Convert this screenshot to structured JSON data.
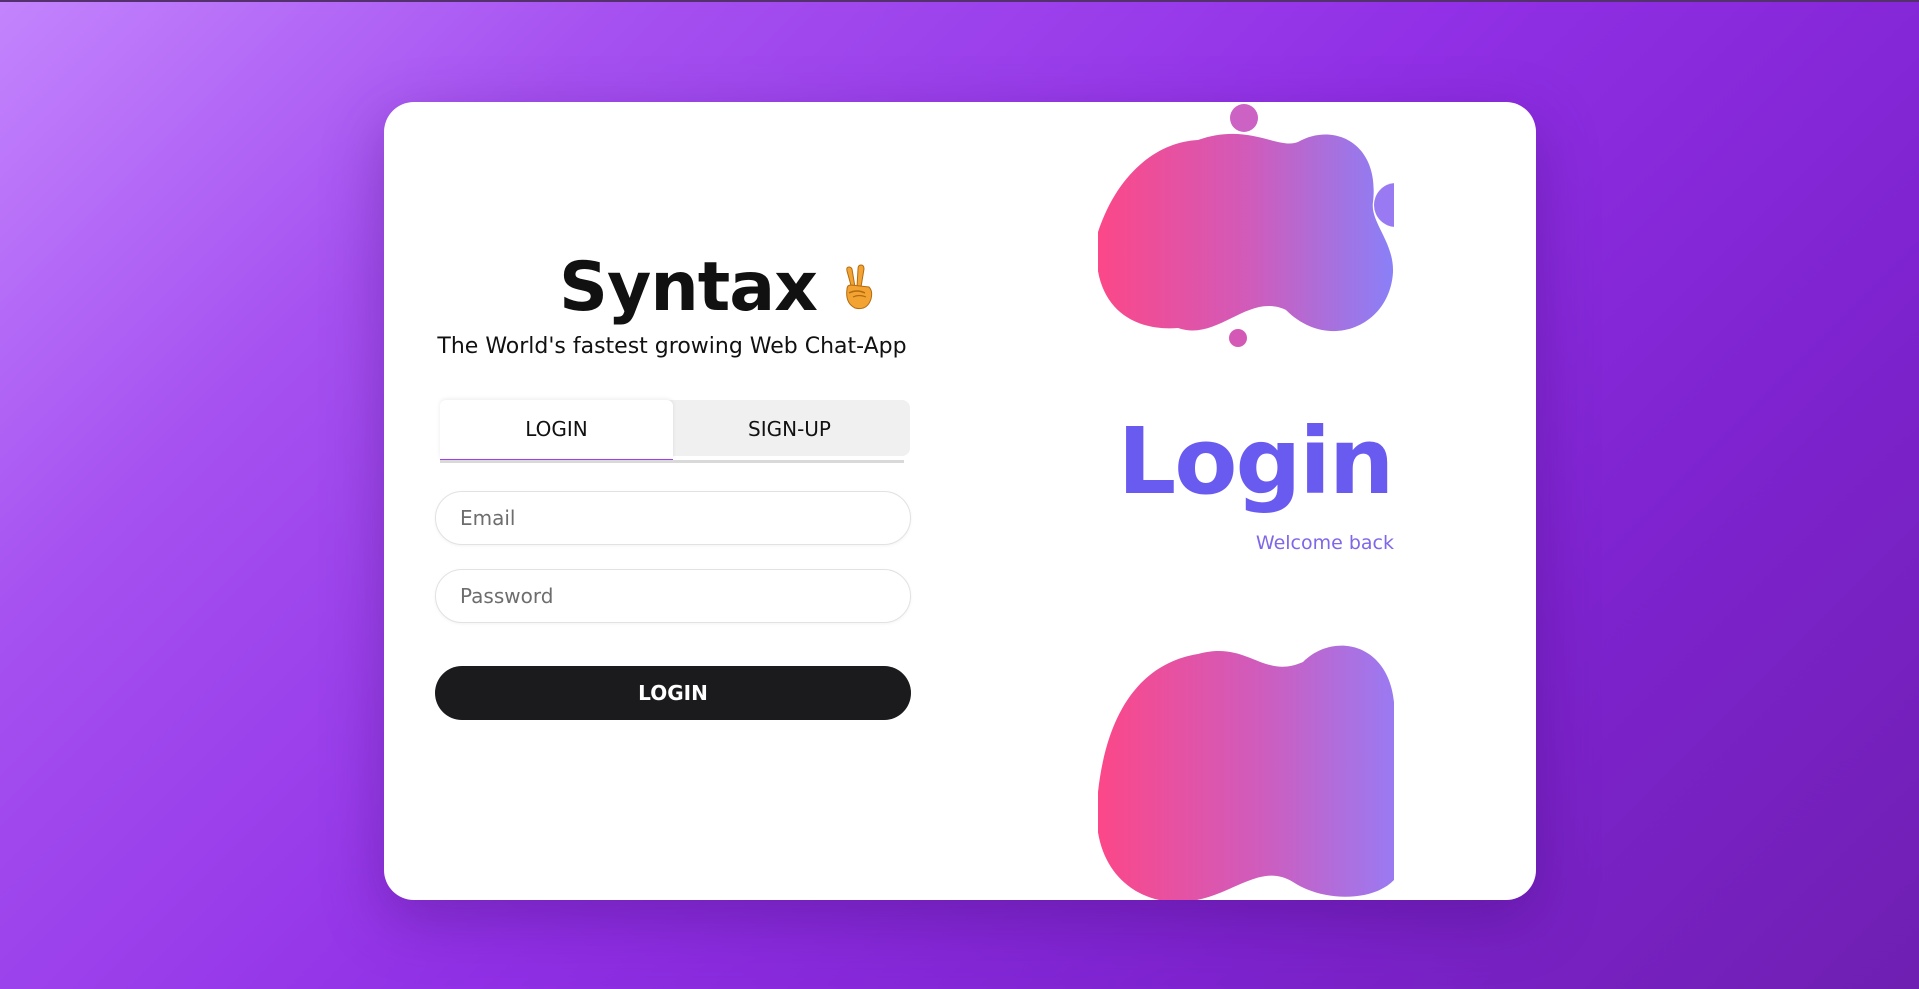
{
  "brand": {
    "title": "Syntax",
    "emoji": "victory-hand-icon",
    "tagline": "The World's fastest growing Web Chat-App"
  },
  "tabs": [
    {
      "label": "LOGIN",
      "active": true
    },
    {
      "label": "SIGN-UP",
      "active": false
    }
  ],
  "form": {
    "email_placeholder": "Email",
    "email_value": "",
    "password_placeholder": "Password",
    "password_value": "",
    "submit_label": "LOGIN"
  },
  "hero": {
    "heading": "Login",
    "subheading": "Welcome back"
  },
  "colors": {
    "accent": "#a23ef0",
    "hero_text": "#6a5bf0",
    "blob_start": "#fc4788",
    "blob_end": "#8a80f8",
    "button": "#1b1b1d"
  }
}
